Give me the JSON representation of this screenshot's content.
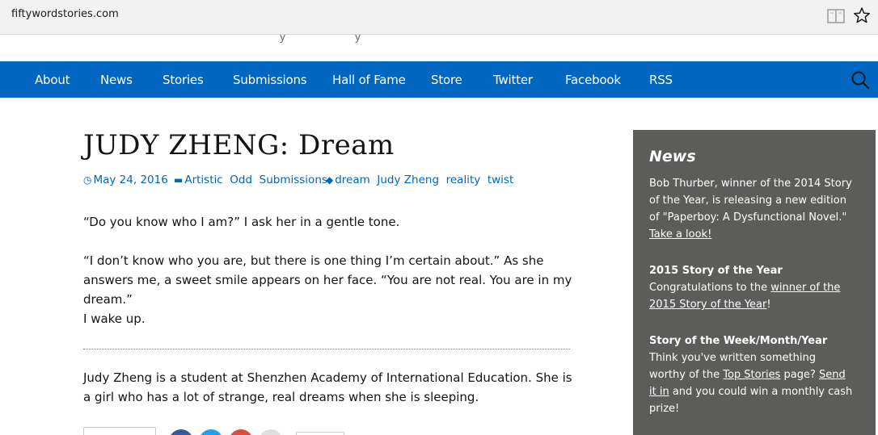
{
  "browser": {
    "url": "fiftywordstories.com",
    "reader_icon": "reader-view-icon",
    "star_icon": "bookmark-star-icon"
  },
  "nav": {
    "items": [
      {
        "label": "About"
      },
      {
        "label": "News"
      },
      {
        "label": "Stories"
      },
      {
        "label": "Submissions"
      },
      {
        "label": "Hall of Fame"
      },
      {
        "label": "Store"
      },
      {
        "label": "Twitter"
      },
      {
        "label": "Facebook"
      },
      {
        "label": "RSS"
      }
    ],
    "search_icon": "search-icon"
  },
  "article": {
    "title": "JUDY ZHENG: Dream",
    "date": "May 24, 2016",
    "categories": [
      "Artistic",
      "Odd",
      "Submissions"
    ],
    "tags": [
      "dream",
      "Judy Zheng",
      "reality",
      "twist"
    ],
    "paragraphs": [
      "“Do you know who I am?” I ask her in a gentle tone.",
      "“I don’t know who you are, but there is one thing I’m certain about.” As she answers me, a sweet smile appears on her face. “You are not real. You are in my dream.”",
      "I wake up."
    ],
    "author_bio": "Judy Zheng is a student at Shenzhen Academy of International Education. She is a girl who has a lot of strange, real dreams when she is sleeping."
  },
  "sidebar": {
    "title": "News",
    "item1": {
      "text": "Bob Thurber, winner of the 2014 Story of the Year, is releasing a new edition of \"Paperboy: A Dysfunctional Novel.\" ",
      "link": "Take a look!"
    },
    "item2": {
      "heading": "2015 Story of the Year",
      "text_before": "Congratulations to the ",
      "link": "winner of the 2015 Story of the Year",
      "text_after": "!"
    },
    "item3": {
      "heading": "Story of the Week/Month/Year",
      "text_before": "Think you've written something worthy of the ",
      "link1": "Top Stories",
      "text_mid": " page? ",
      "link2": "Send it in",
      "text_after": " and you could win a monthly cash prize!"
    }
  },
  "colors": {
    "nav_bg": "#0066bf",
    "link": "#0066bf",
    "sidebar_bg": "#5c5c5a",
    "share_facebook": "#3b5998",
    "share_twitter": "#1da1f2",
    "share_google": "#dd4b39",
    "share_more": "#e0e0e0"
  }
}
